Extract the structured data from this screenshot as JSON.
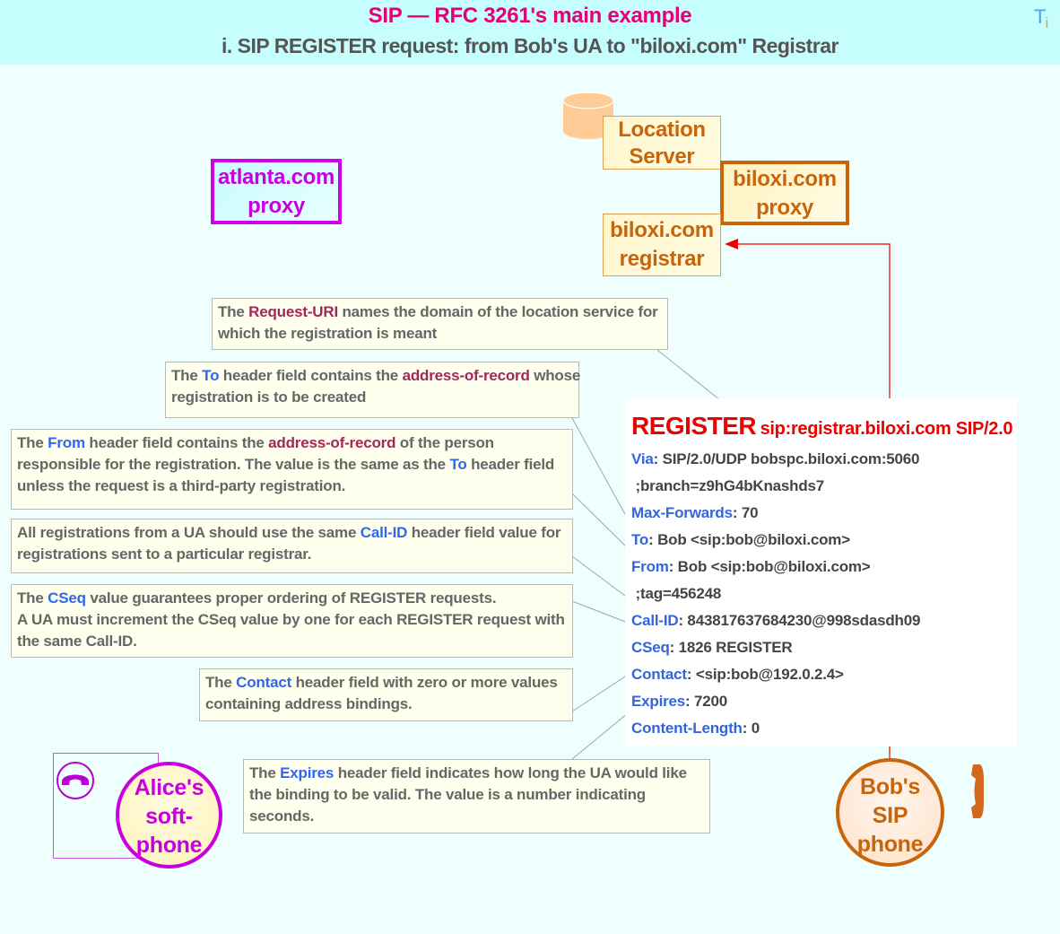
{
  "header": {
    "title": "SIP — RFC 3261's main example",
    "subtitle": "i.  SIP REGISTER request: from Bob's UA to \"biloxi.com\" Registrar",
    "logo_main": "T",
    "logo_sub": "i"
  },
  "nodes": {
    "location_server": [
      "Location",
      "Server"
    ],
    "biloxi_proxy": [
      "biloxi.com",
      "proxy"
    ],
    "biloxi_registrar": [
      "biloxi.com",
      "registrar"
    ],
    "atlanta_proxy": [
      "atlanta.com",
      "proxy"
    ],
    "alice": [
      "Alice's",
      "soft-",
      "phone"
    ],
    "bob": [
      "Bob's",
      "SIP",
      "phone"
    ]
  },
  "message": {
    "method": "REGISTER",
    "request_uri": "sip:registrar.biloxi.com SIP/2.0",
    "headers": [
      {
        "name": "Via",
        "value": ": SIP/2.0/UDP bobspc.biloxi.com:5060"
      },
      {
        "name": "",
        "value": " ;branch=z9hG4bKnashds7"
      },
      {
        "name": "Max-Forwards",
        "value": ": 70"
      },
      {
        "name": "To",
        "value": ": Bob <sip:bob@biloxi.com>"
      },
      {
        "name": "From",
        "value": ": Bob <sip:bob@biloxi.com>"
      },
      {
        "name": "",
        "value": " ;tag=456248"
      },
      {
        "name": "Call-ID",
        "value": ": 843817637684230@998sdasdh09"
      },
      {
        "name": "CSeq",
        "value": ": 1826 REGISTER"
      },
      {
        "name": "Contact",
        "value": ": <sip:bob@192.0.2.4>"
      },
      {
        "name": "Expires",
        "value": ": 7200"
      },
      {
        "name": "Content-Length",
        "value": ": 0"
      }
    ]
  },
  "notes": {
    "request_uri": {
      "l1a": "The ",
      "l1b": "Request-URI",
      "l1c": " names the domain of the location service for",
      "l2": "which the registration is meant"
    },
    "to": {
      "l1a": "The ",
      "l1b": "To",
      "l1c": " header field contains the ",
      "l1d": "address-of-record",
      "l1e": " whose",
      "l2": "registration is to be created"
    },
    "from": {
      "l1a": "The ",
      "l1b": "From",
      "l1c": " header field contains the ",
      "l1d": "address-of-record",
      "l1e": " of the person",
      "l2a": "responsible for the registration. The value is the same as the ",
      "l2b": "To",
      "l2c": " header field",
      "l3": "unless the request is a third-party registration."
    },
    "callid": {
      "l1a": "All registrations from a UA should use the same ",
      "l1b": "Call-ID",
      "l1c": " header field value for",
      "l2": "registrations sent to a particular registrar."
    },
    "cseq": {
      "l1a": "The ",
      "l1b": "CSeq",
      "l1c": " value guarantees proper ordering of REGISTER requests.",
      "l2": "A UA must increment the CSeq value by one for each REGISTER request with",
      "l3": "the same Call-ID."
    },
    "contact": {
      "l1a": "The ",
      "l1b": "Contact",
      "l1c": " header field with zero or more values",
      "l2": "containing address bindings."
    },
    "expires": {
      "l1a": "The ",
      "l1b": "Expires",
      "l1c": " header field indicates how long the UA would like",
      "l2": "the binding to be valid. The value is a number indicating",
      "l3": "seconds."
    }
  },
  "colors": {
    "title": "#e60073",
    "biloxi": "#c8640a",
    "atlanta": "#c800e0",
    "request_arrow": "#ee0000",
    "header_key": "#3366dd",
    "term": "#a0285a"
  }
}
